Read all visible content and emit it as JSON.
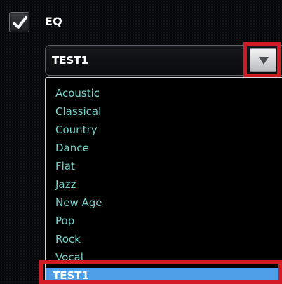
{
  "colors": {
    "background": "#070809",
    "list_text": "#74d4cb",
    "selection_bg": "#4f9fe8",
    "highlight_outline": "#d11a24"
  },
  "eq": {
    "checked": true,
    "label": "EQ",
    "selected_value": "TEST1"
  },
  "icons": {
    "checkbox": "checkmark-icon",
    "dropdown": "triangle-down-icon"
  },
  "presets": [
    "Acoustic",
    "Classical",
    "Country",
    "Dance",
    "Flat",
    "Jazz",
    "New Age",
    "Pop",
    "Rock",
    "Vocal",
    "TEST1"
  ]
}
